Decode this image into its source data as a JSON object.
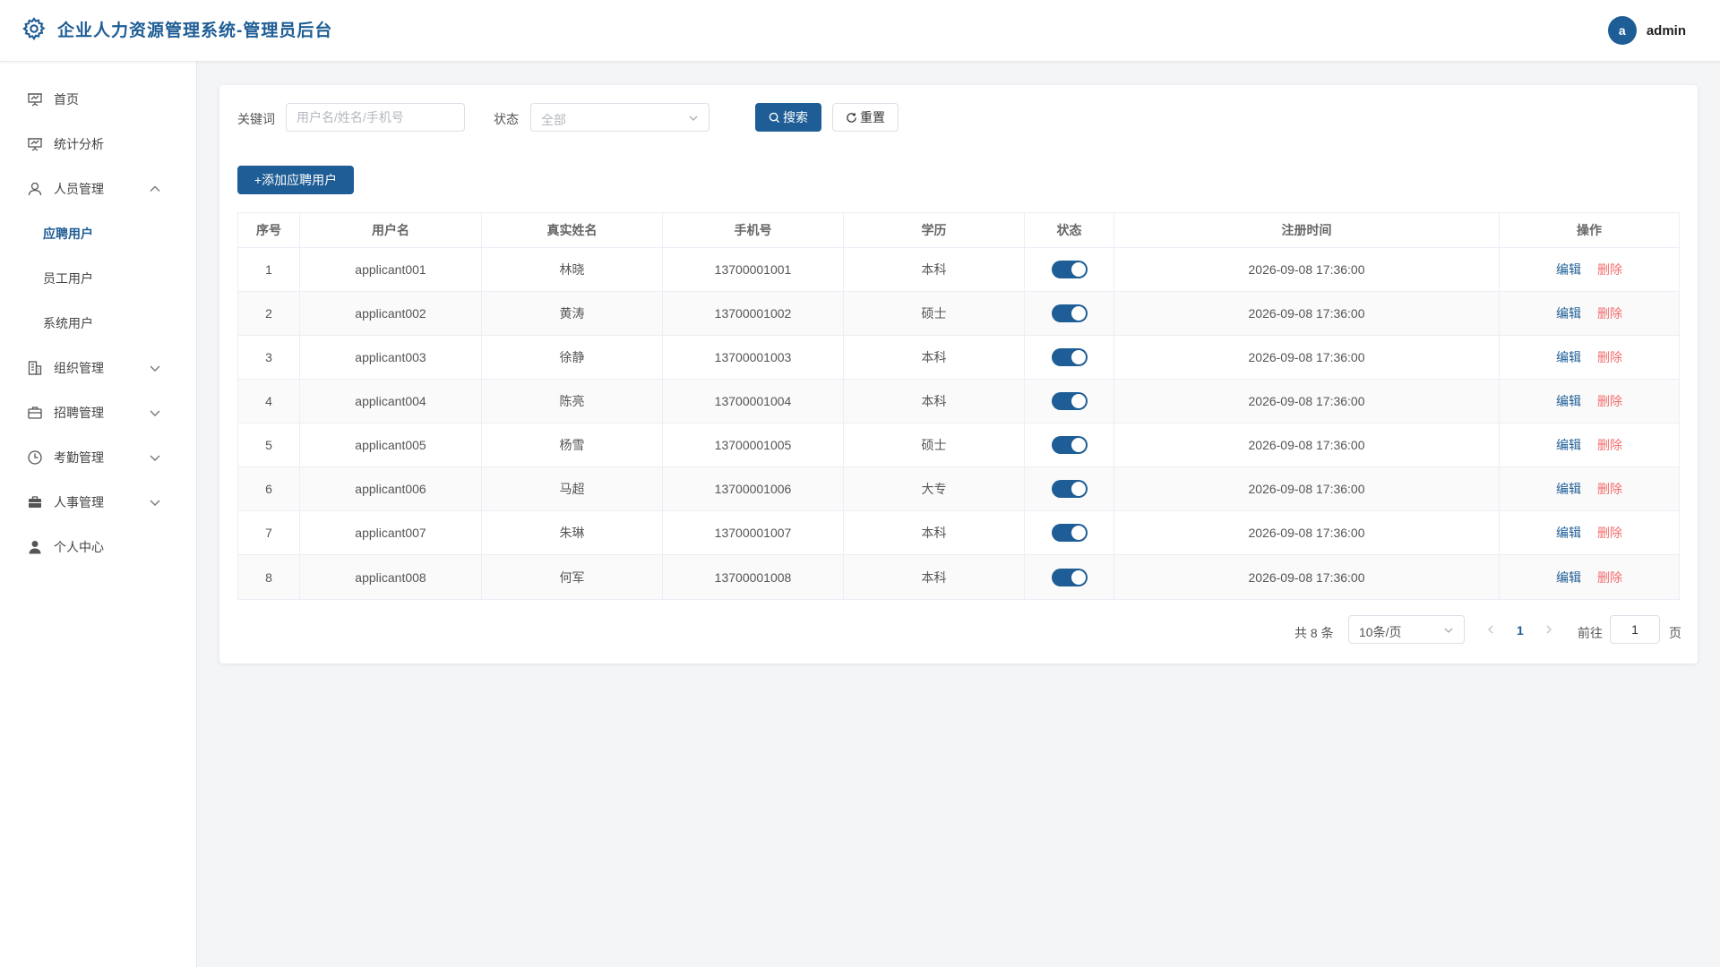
{
  "header": {
    "title": "企业人力资源管理系统-管理员后台",
    "avatar_letter": "a",
    "username": "admin"
  },
  "sidebar": {
    "items": [
      {
        "label": "首页",
        "icon": "presentation-icon"
      },
      {
        "label": "统计分析",
        "icon": "presentation-icon"
      },
      {
        "label": "人员管理",
        "icon": "user-icon",
        "expanded": true
      },
      {
        "label": "组织管理",
        "icon": "building-icon"
      },
      {
        "label": "招聘管理",
        "icon": "briefcase-icon"
      },
      {
        "label": "考勤管理",
        "icon": "clock-icon"
      },
      {
        "label": "人事管理",
        "icon": "suitcase-icon"
      },
      {
        "label": "个人中心",
        "icon": "person-icon"
      }
    ],
    "sub_items": [
      {
        "label": "应聘用户",
        "active": true
      },
      {
        "label": "员工用户"
      },
      {
        "label": "系统用户"
      }
    ]
  },
  "search": {
    "keyword_label": "关键词",
    "keyword_placeholder": "用户名/姓名/手机号",
    "status_label": "状态",
    "status_value": "全部",
    "search_button": "搜索",
    "reset_button": "重置"
  },
  "add_button": "+添加应聘用户",
  "table": {
    "columns": [
      "序号",
      "用户名",
      "真实姓名",
      "手机号",
      "学历",
      "状态",
      "注册时间",
      "操作"
    ],
    "edit_label": "编辑",
    "delete_label": "删除",
    "rows": [
      {
        "no": "1",
        "username": "applicant001",
        "name": "林晓",
        "phone": "13700001001",
        "edu": "本科",
        "enabled": true,
        "time": "2026-09-08 17:36:00"
      },
      {
        "no": "2",
        "username": "applicant002",
        "name": "黄涛",
        "phone": "13700001002",
        "edu": "硕士",
        "enabled": true,
        "time": "2026-09-08 17:36:00"
      },
      {
        "no": "3",
        "username": "applicant003",
        "name": "徐静",
        "phone": "13700001003",
        "edu": "本科",
        "enabled": true,
        "time": "2026-09-08 17:36:00"
      },
      {
        "no": "4",
        "username": "applicant004",
        "name": "陈亮",
        "phone": "13700001004",
        "edu": "本科",
        "enabled": true,
        "time": "2026-09-08 17:36:00"
      },
      {
        "no": "5",
        "username": "applicant005",
        "name": "杨雪",
        "phone": "13700001005",
        "edu": "硕士",
        "enabled": true,
        "time": "2026-09-08 17:36:00"
      },
      {
        "no": "6",
        "username": "applicant006",
        "name": "马超",
        "phone": "13700001006",
        "edu": "大专",
        "enabled": true,
        "time": "2026-09-08 17:36:00"
      },
      {
        "no": "7",
        "username": "applicant007",
        "name": "朱琳",
        "phone": "13700001007",
        "edu": "本科",
        "enabled": true,
        "time": "2026-09-08 17:36:00"
      },
      {
        "no": "8",
        "username": "applicant008",
        "name": "何军",
        "phone": "13700001008",
        "edu": "本科",
        "enabled": true,
        "time": "2026-09-08 17:36:00"
      }
    ]
  },
  "pagination": {
    "total_text": "共 8 条",
    "page_size": "10条/页",
    "current_page": "1",
    "goto_label": "前往",
    "goto_value": "1",
    "page_suffix": "页"
  },
  "colors": {
    "primary": "#1e5d95",
    "danger": "#f56c6c"
  }
}
